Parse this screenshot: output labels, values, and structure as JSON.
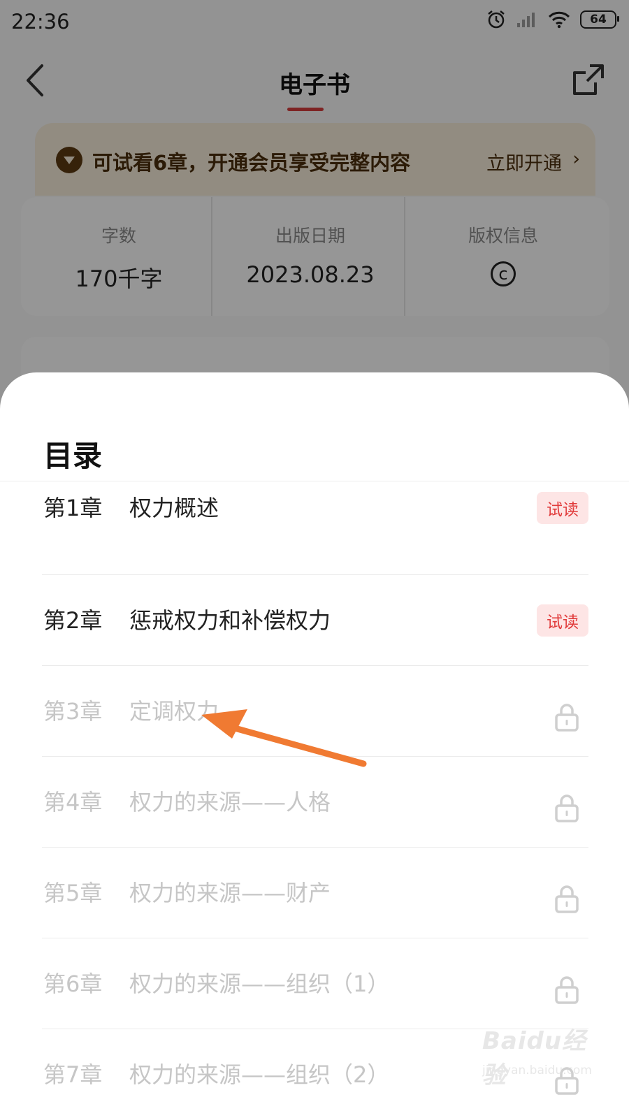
{
  "status_bar": {
    "time": "22:36",
    "battery": "64"
  },
  "nav": {
    "title": "电子书"
  },
  "vip_banner": {
    "text": "可试看6章，开通会员享受完整内容",
    "action": "立即开通"
  },
  "book_info": [
    {
      "label": "字数",
      "value": "170千字"
    },
    {
      "label": "出版日期",
      "value": "2023.08.23"
    },
    {
      "label": "版权信息",
      "icon": "copyright-icon"
    }
  ],
  "toc": {
    "title": "目录",
    "trial_badge": "试读",
    "chapters": [
      {
        "num": "第1章",
        "title": "权力概述",
        "status": "trial"
      },
      {
        "num": "第2章",
        "title": "惩戒权力和补偿权力",
        "status": "trial"
      },
      {
        "num": "第3章",
        "title": "定调权力",
        "status": "locked"
      },
      {
        "num": "第4章",
        "title": "权力的来源——人格",
        "status": "locked"
      },
      {
        "num": "第5章",
        "title": "权力的来源——财产",
        "status": "locked"
      },
      {
        "num": "第6章",
        "title": "权力的来源——组织（1）",
        "status": "locked"
      },
      {
        "num": "第7章",
        "title": "权力的来源——组织（2）",
        "status": "locked"
      }
    ]
  },
  "watermark": {
    "main": "Baidu经验",
    "sub": "jingyan.baidu.com"
  },
  "colors": {
    "accent": "#d23c3c",
    "trial_badge_bg": "#fde5e5",
    "annotation_arrow": "#f07a32",
    "vip_text": "#4a2d0c"
  }
}
